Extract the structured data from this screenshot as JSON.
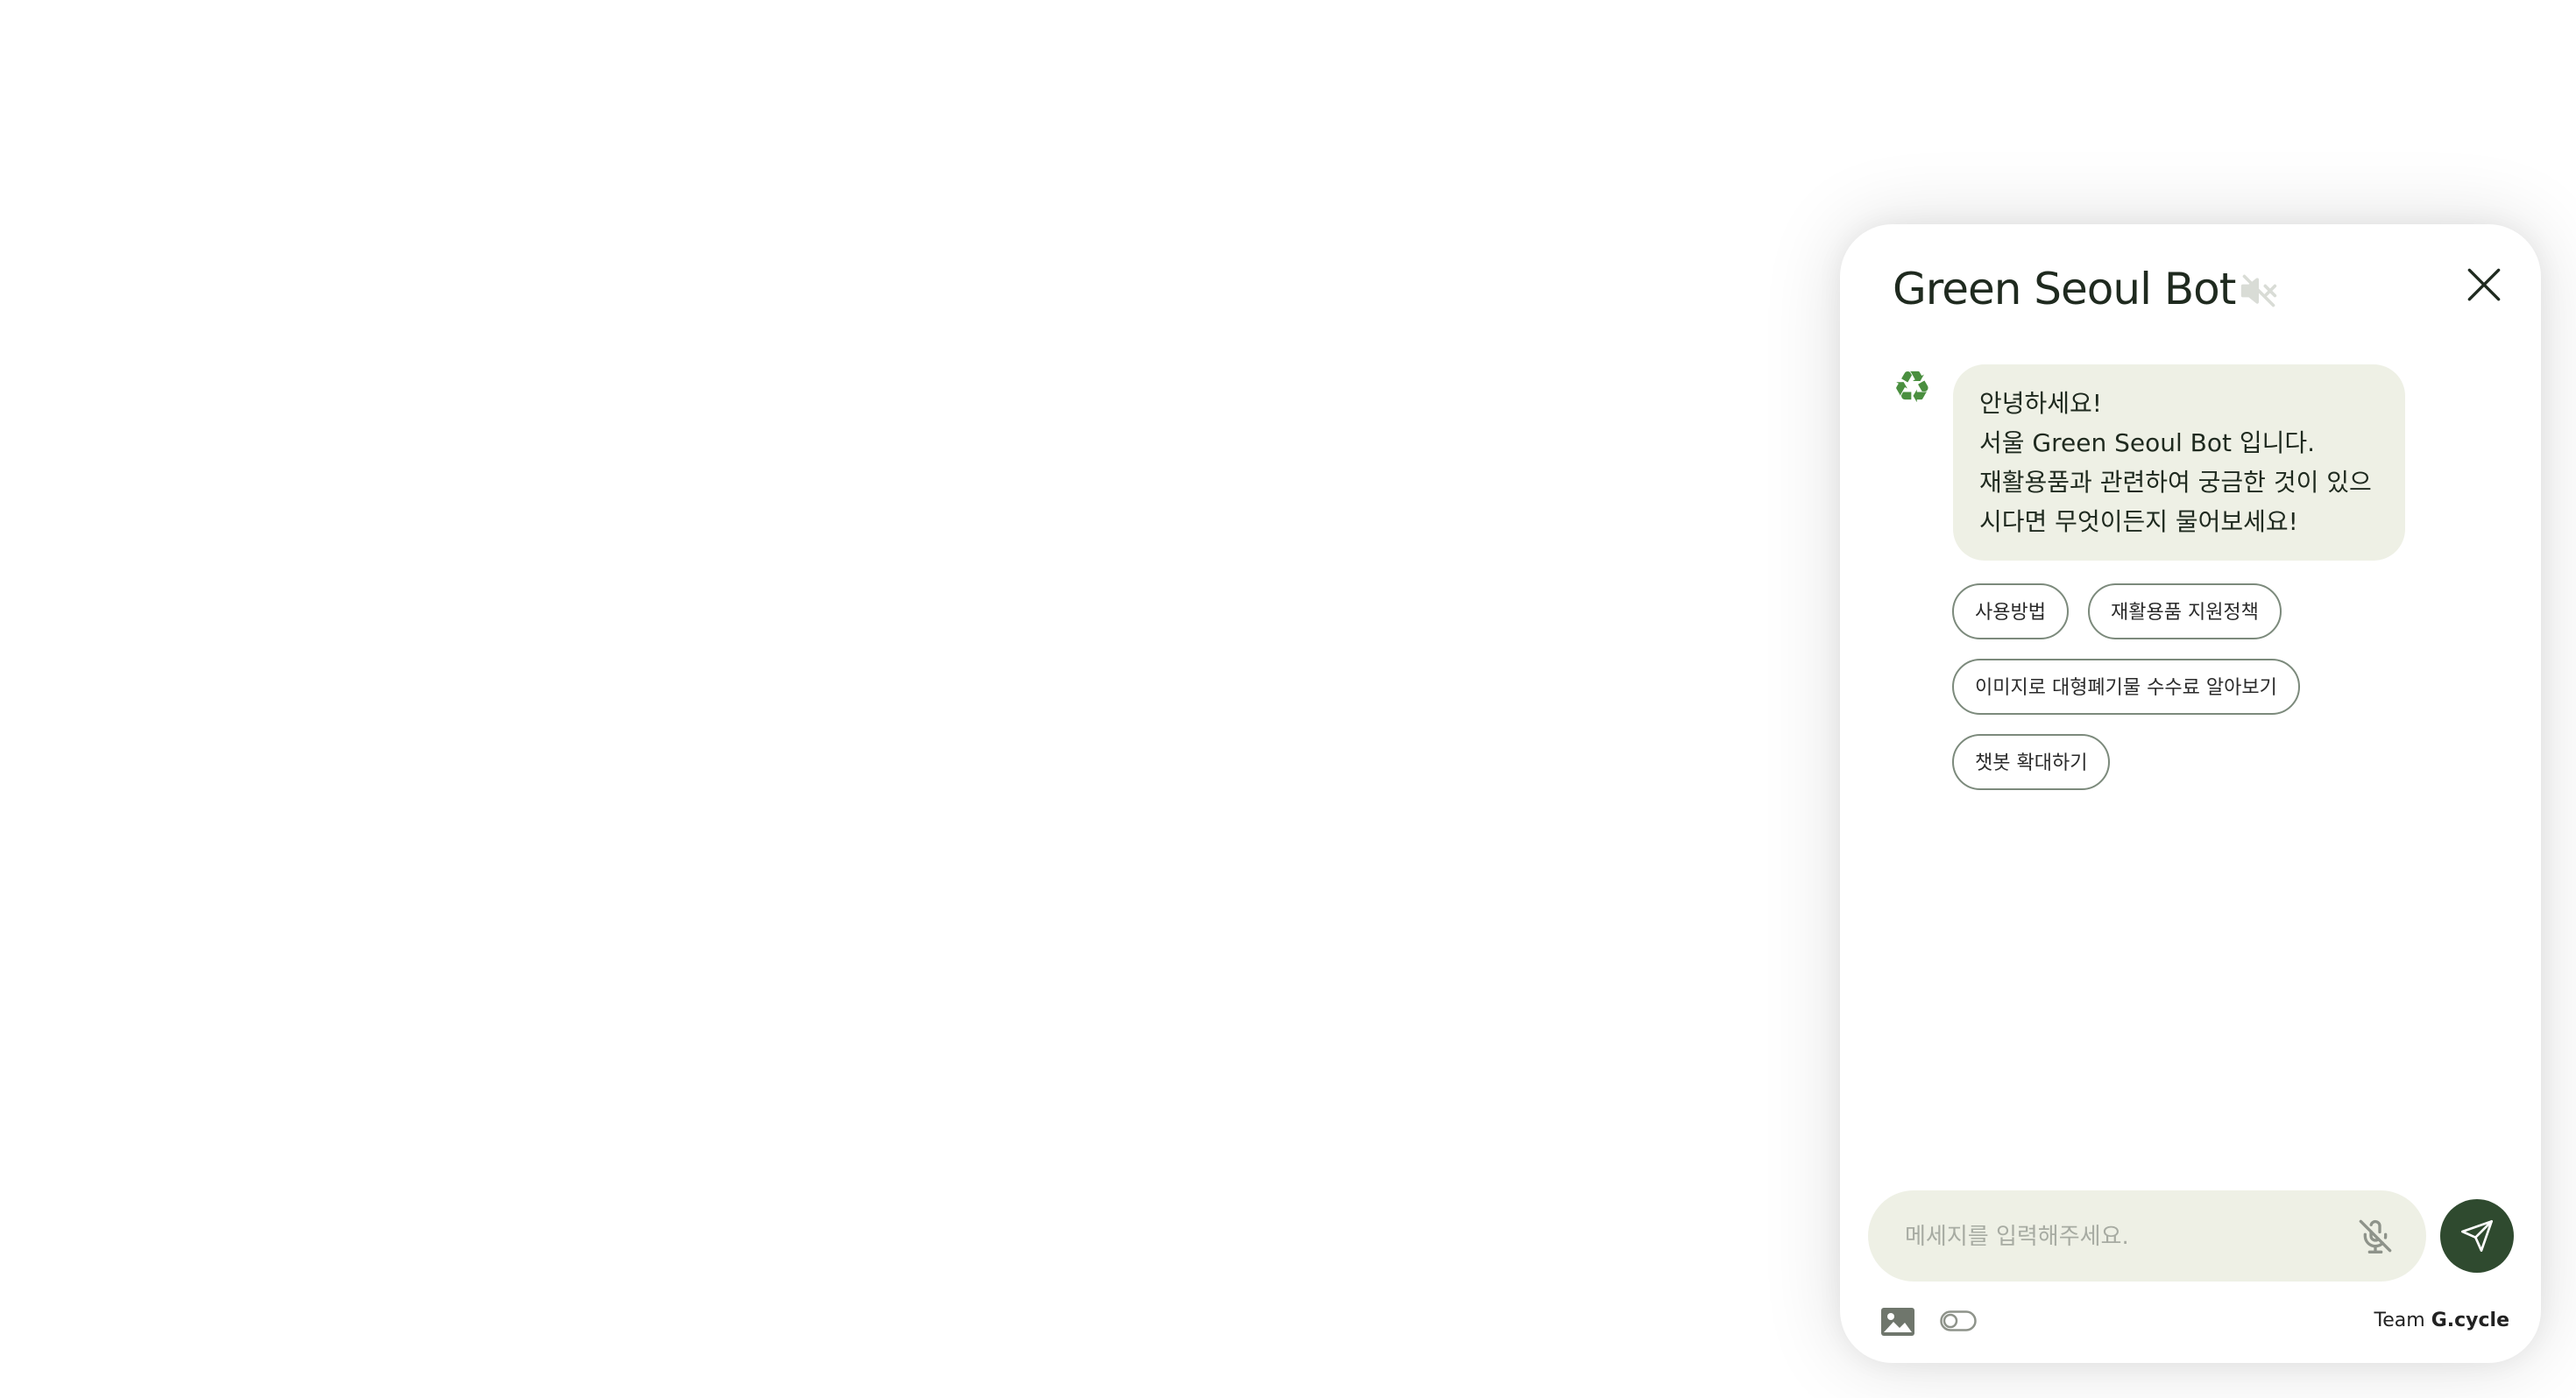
{
  "header": {
    "title": "Green Seoul Bot",
    "mute_icon": "speaker-muted-icon",
    "close_icon": "close-icon"
  },
  "messages": [
    {
      "sender": "bot",
      "avatar_icon": "recycle-icon",
      "avatar_glyph": "♻",
      "lines": [
        "안녕하세요!",
        "서울 Green Seoul Bot 입니다.",
        "재활용품과 관련하여 궁금한 것이 있으",
        "시다면 무엇이든지 물어보세요!"
      ]
    }
  ],
  "quick_replies": [
    "사용방법",
    "재활용품 지원정책",
    "이미지로 대형폐기물 수수료 알아보기",
    "챗봇 확대하기"
  ],
  "composer": {
    "placeholder": "메세지를 입력해주세요.",
    "value": "",
    "mic_icon": "mic-off-icon",
    "send_icon": "send-icon"
  },
  "footer": {
    "image_icon": "image-icon",
    "toggle_icon": "toggle-icon",
    "credit_prefix": "Team",
    "credit_name": "G.cycle"
  },
  "colors": {
    "accent": "#2f4a2f",
    "bubble_bg": "#eef0e5",
    "avatar": "#4a8f3f"
  }
}
